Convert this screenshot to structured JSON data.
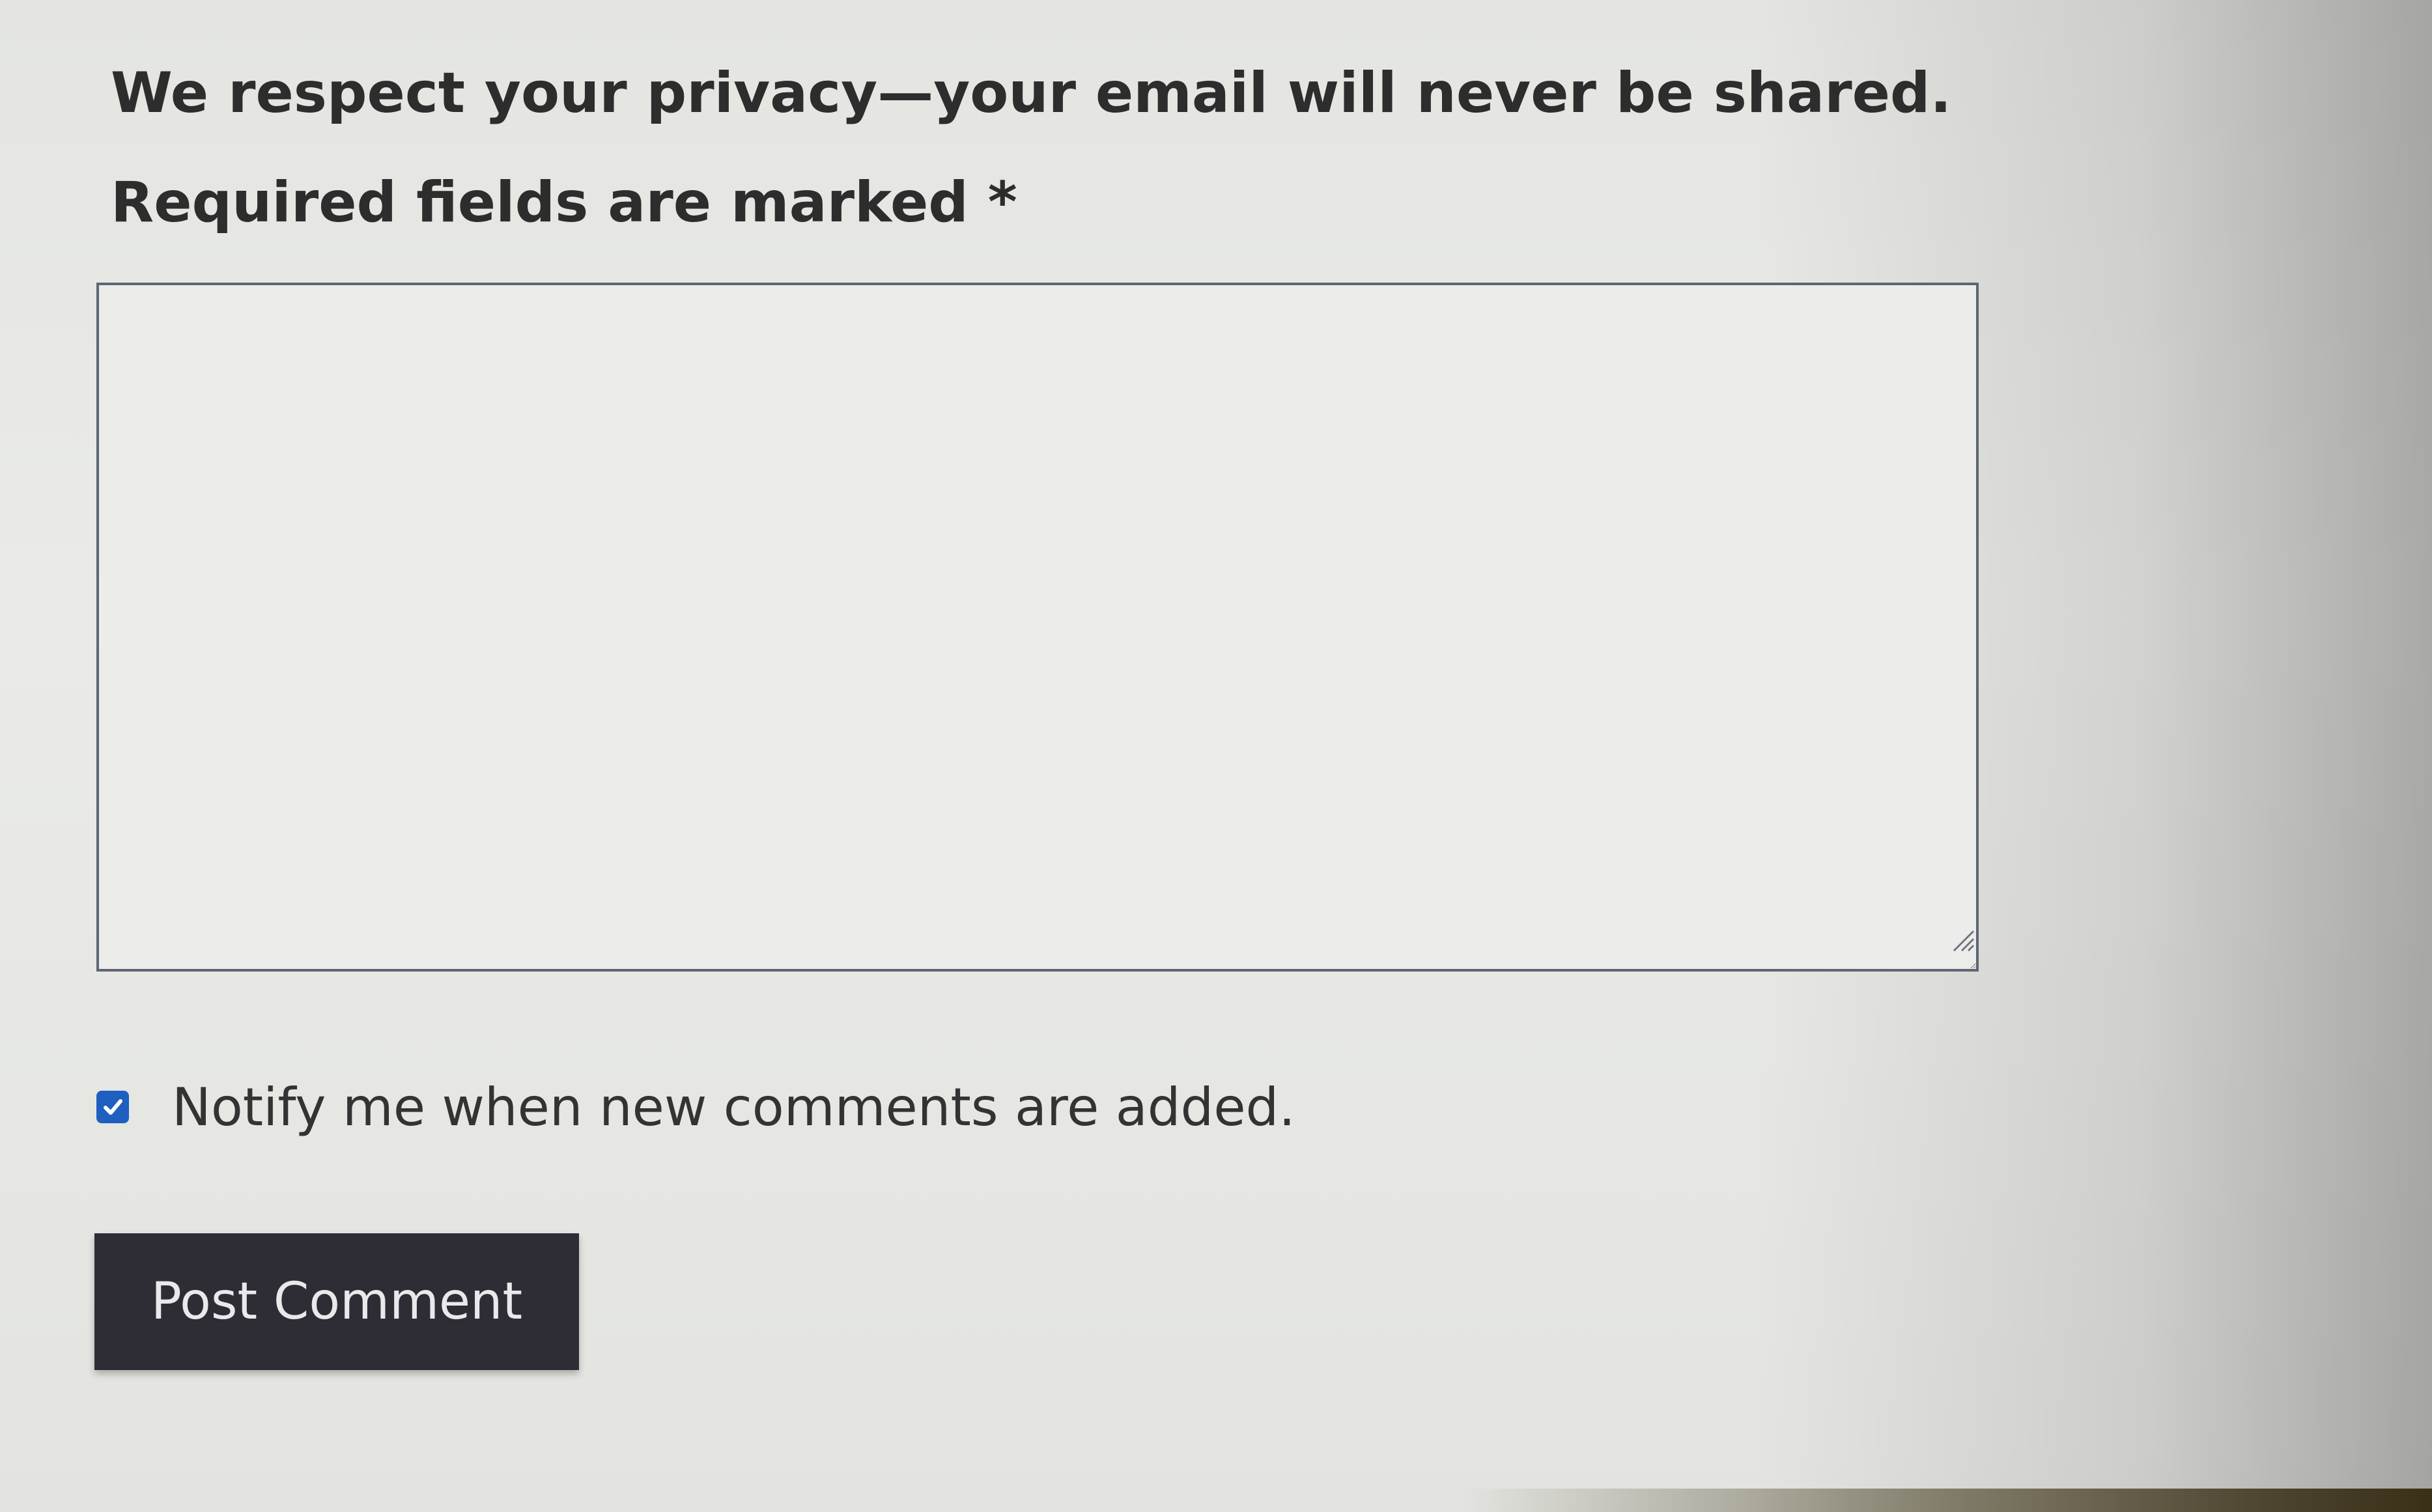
{
  "form": {
    "privacy_note": "We respect your privacy—your email will never be shared.",
    "required_note": "Required fields are marked *",
    "comment_textarea": {
      "value": "",
      "placeholder": ""
    },
    "notify_checkbox": {
      "checked": true,
      "label": "Notify me when new comments are added."
    },
    "submit_label": "Post Comment"
  },
  "icons": {
    "checkbox_check": "checkmark-icon",
    "textarea_resize": "resize-grip-icon"
  },
  "colors": {
    "page_background": "#e6e7e3",
    "text": "#2c2d2c",
    "checkbox_fill": "#1f5fbf",
    "button_background": "#2e2d36",
    "button_text": "#e9e9ec",
    "textarea_border": "#5d6675"
  }
}
